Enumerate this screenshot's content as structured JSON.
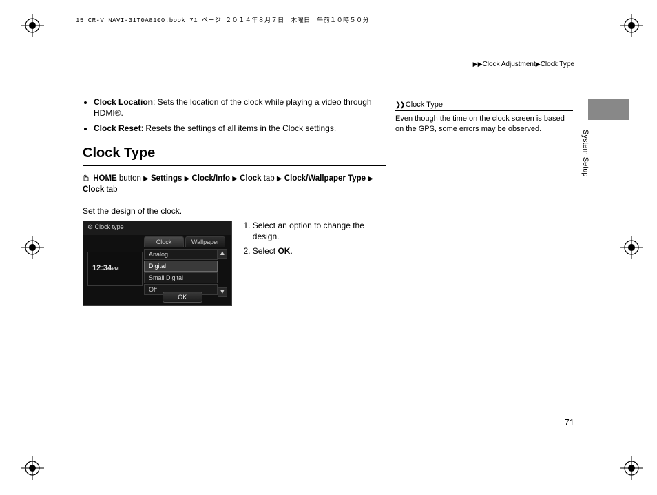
{
  "film_header": "15 CR-V NAVI-31T0A8100.book  71 ページ  ２０１４年８月７日　木曜日　午前１０時５０分",
  "breadcrumb": {
    "a": "Clock Adjustment",
    "b": "Clock Type"
  },
  "bullets": {
    "loc_label": "Clock Location",
    "loc_text": ": Sets the location of the clock while playing a video through HDMI®.",
    "reset_label": "Clock Reset",
    "reset_text": ": Resets the settings of all items in the Clock settings."
  },
  "heading": "Clock Type",
  "nav": {
    "home": "HOME",
    "button_word": "button",
    "settings": "Settings",
    "clockinfo": "Clock/Info",
    "clock_tab": "Clock",
    "tab_word": "tab",
    "cwtype": "Clock/Wallpaper Type",
    "clock_tab2": "Clock"
  },
  "lead": "Set the design of the clock.",
  "shot": {
    "title": "Clock type",
    "tab_clock": "Clock",
    "tab_wall": "Wallpaper",
    "preview_time": "12:34",
    "opts": [
      "Analog",
      "Digital",
      "Small Digital",
      "Off"
    ],
    "selected_index": 1,
    "ok": "OK"
  },
  "steps": {
    "s1": "Select an option to change the design.",
    "s2_a": "Select ",
    "s2_b": "OK",
    "s2_c": "."
  },
  "note": {
    "title": "Clock Type",
    "body": "Even though the time on the clock screen is based on the GPS, some errors may be observed."
  },
  "side_label": "System Setup",
  "page_number": "71"
}
